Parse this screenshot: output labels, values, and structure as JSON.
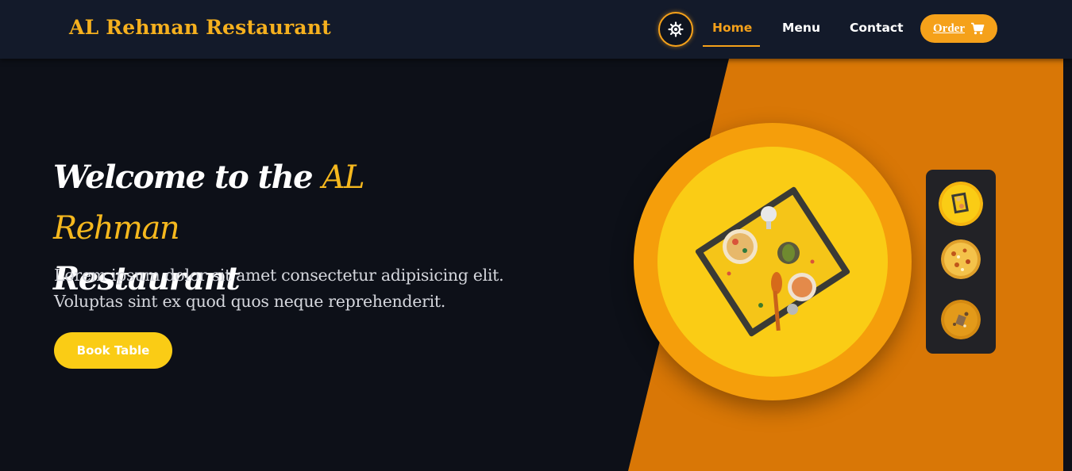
{
  "brand": {
    "name": "AL Rehman Restaurant"
  },
  "nav": {
    "theme_icon": "sun-gear-icon",
    "links": [
      {
        "label": "Home",
        "active": true
      },
      {
        "label": "Menu",
        "active": false
      },
      {
        "label": "Contact",
        "active": false
      }
    ],
    "order": {
      "label": "Order",
      "icon": "cart-icon"
    }
  },
  "hero": {
    "headline_prefix": "Welcome to the",
    "headline_accent": "AL Rehman",
    "headline_suffix": "Restaurant",
    "subtext_line1": "Lorem ipsum dolor sit amet consectetur adipisicing elit.",
    "subtext_line2": "Voluptas sint ex quod quos neque reprehenderit.",
    "cta_label": "Book Table",
    "featured_dish": "tray-of-dishes-photo",
    "thumbnails": [
      "tray-dishes-thumb",
      "pizza-thumb",
      "spices-thumb"
    ]
  },
  "colors": {
    "background": "#0d1018",
    "navbar": "#131a2a",
    "accent": "#f5a11a",
    "panel": "#d97706",
    "cta": "#facc15"
  }
}
